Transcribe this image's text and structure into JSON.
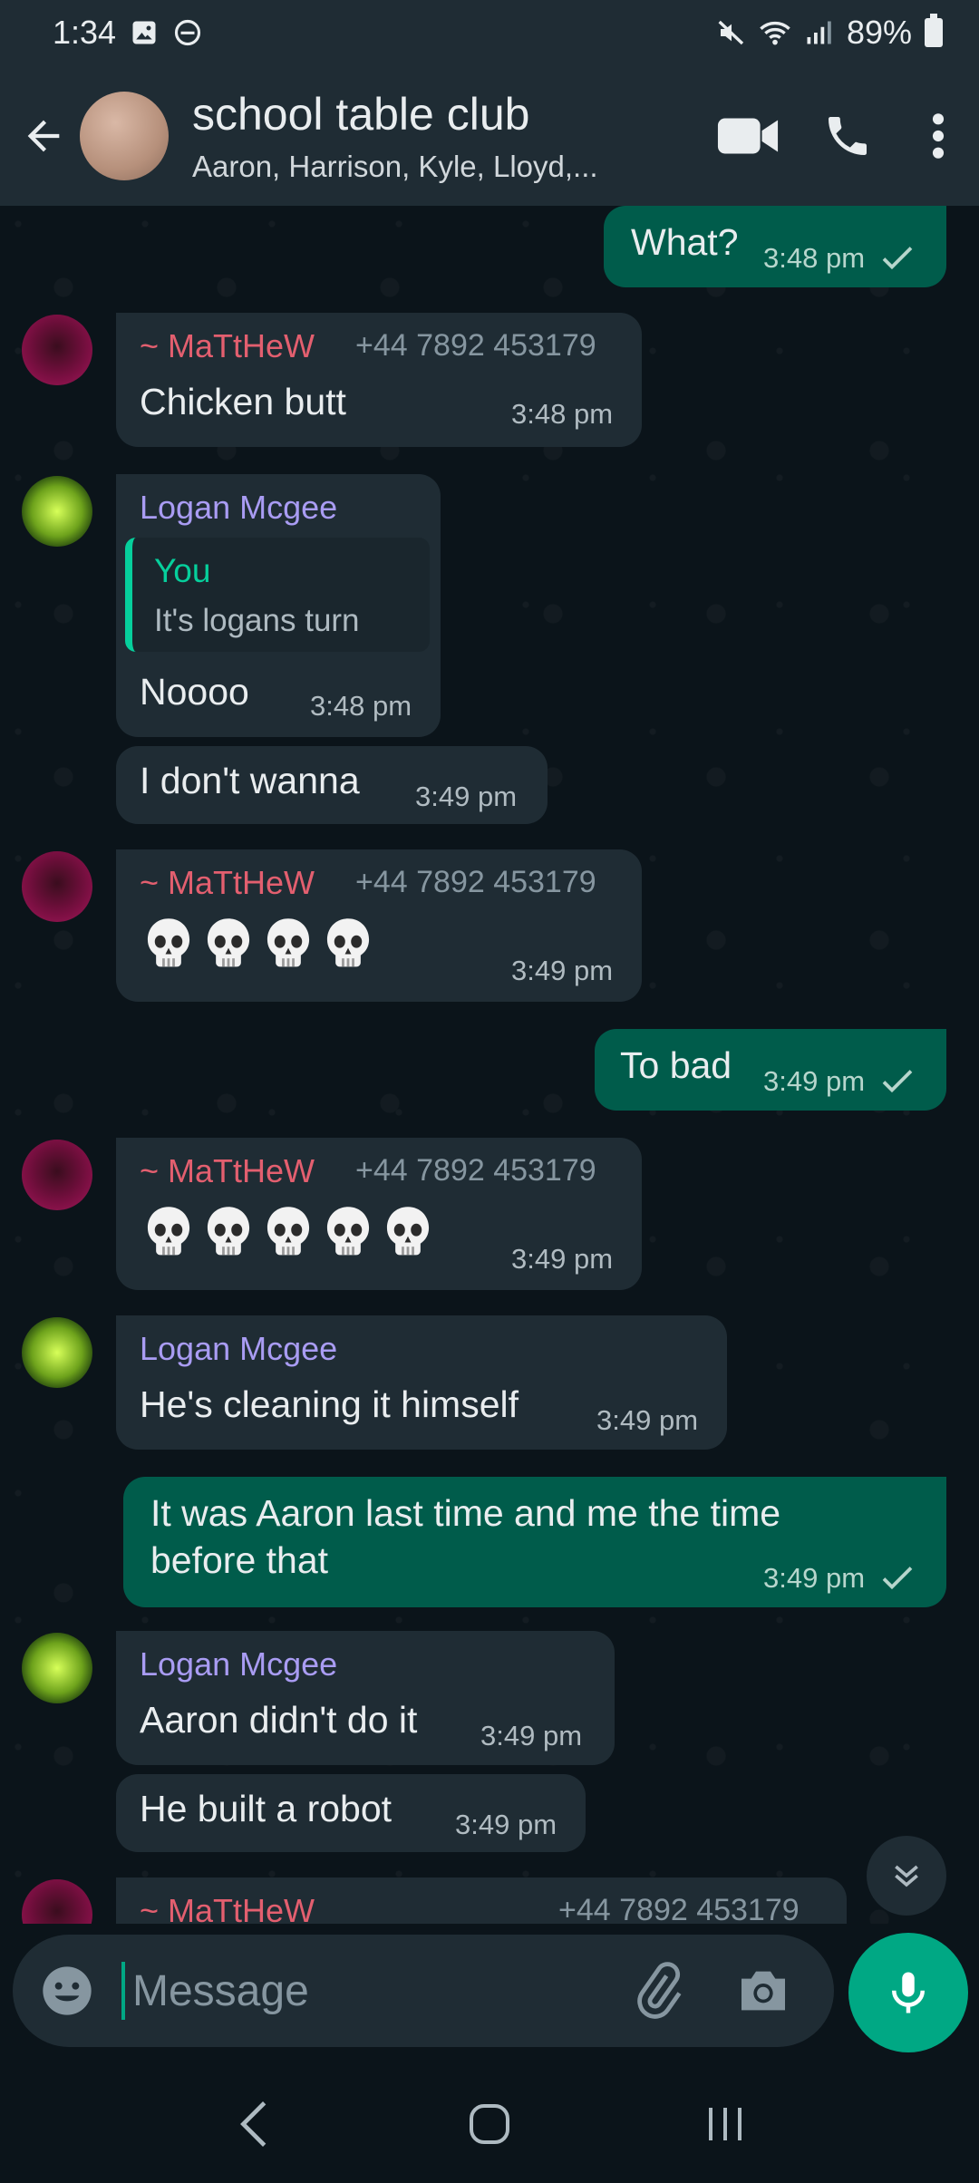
{
  "status_bar": {
    "time": "1:34",
    "battery": "89%"
  },
  "header": {
    "title": "school table club",
    "subtitle": "Aaron, Harrison, Kyle, Lloyd,..."
  },
  "messages": [
    {
      "dir": "out",
      "text": "What?",
      "time": "3:48 pm"
    },
    {
      "dir": "in",
      "sender": "~ MaTtHeW",
      "phone": "+44 7892 453179",
      "text": "Chicken butt",
      "time": "3:48 pm"
    },
    {
      "dir": "in",
      "sender": "Logan Mcgee",
      "quote_name": "You",
      "quote_text": "It's logans turn",
      "text": "Noooo",
      "time": "3:48 pm"
    },
    {
      "dir": "in",
      "text": "I don't wanna",
      "time": "3:49 pm"
    },
    {
      "dir": "in",
      "sender": "~ MaTtHeW",
      "phone": "+44 7892 453179",
      "emoji_count": 4,
      "time": "3:49 pm"
    },
    {
      "dir": "out",
      "text": "To bad",
      "time": "3:49 pm"
    },
    {
      "dir": "in",
      "sender": "~ MaTtHeW",
      "phone": "+44 7892 453179",
      "emoji_count": 5,
      "time": "3:49 pm"
    },
    {
      "dir": "in",
      "sender": "Logan Mcgee",
      "text": "He's cleaning it himself",
      "time": "3:49 pm"
    },
    {
      "dir": "out",
      "text": "It was Aaron last time and me the time before that",
      "time": "3:49 pm"
    },
    {
      "dir": "in",
      "sender": "Logan Mcgee",
      "text": "Aaron didn't do it",
      "time": "3:49 pm"
    },
    {
      "dir": "in",
      "text": "He built a robot",
      "time": "3:49 pm"
    },
    {
      "dir": "in",
      "sender": "~ MaTtHeW",
      "phone": "+44 7892 453179"
    }
  ],
  "input": {
    "placeholder": "Message"
  },
  "icons": {
    "back": "arrow-left-icon",
    "video": "video-call-icon",
    "call": "phone-icon",
    "menu": "more-vertical-icon",
    "emoji": "emoji-icon",
    "attach": "paperclip-icon",
    "camera": "camera-icon",
    "mic": "mic-icon",
    "skull": "skull-emoji",
    "scroll_down": "double-chevron-down-icon"
  },
  "colors": {
    "accent": "#00a884",
    "outgoing": "#005c4b",
    "incoming": "#1f2c34",
    "matthew": "#e35f6f",
    "logan": "#a99cf3"
  }
}
